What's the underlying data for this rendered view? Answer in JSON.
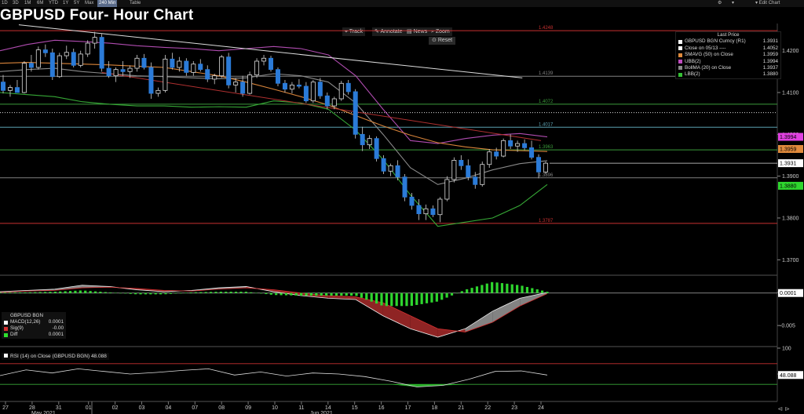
{
  "topbar": {
    "ranges": [
      "1D",
      "3D",
      "1M",
      "6M",
      "YTD",
      "1Y",
      "5Y",
      "Max",
      "240 Min",
      "Table"
    ],
    "active": "240 Min",
    "edit_chart": "Edit Chart"
  },
  "title": "GBPUSD Four- Hour Chart",
  "toolbar": {
    "track": "Track",
    "annotate": "Annotate",
    "news": "News",
    "zoom": "Zoom",
    "reset": "Reset"
  },
  "legend": {
    "header": "Last Price",
    "rows": [
      {
        "label": "GBPUSD BGN Curncy  (R1)",
        "value": "1.3931",
        "color": "#ffffff"
      },
      {
        "label": "Close on 05/13 ----",
        "value": "1.4052",
        "color": "#ffffff"
      },
      {
        "label": "SMAVG (50)  on Close",
        "value": "1.3959",
        "color": "#e08a3c"
      },
      {
        "label": "UBB(2)",
        "value": "1.3994",
        "color": "#c04cc0"
      },
      {
        "label": "BollMA (20)  on Close",
        "value": "1.3937",
        "color": "#8a8a8a"
      },
      {
        "label": "LBB(2)",
        "value": "1.3880",
        "color": "#35c035"
      }
    ]
  },
  "macd_legend": {
    "header": "GBPUSD BGN",
    "rows": [
      {
        "label": "MACD(12,26)",
        "value": "0.0001",
        "color": "#ffffff"
      },
      {
        "label": "Sig(9)",
        "value": "-0.00",
        "color": "#d43030"
      },
      {
        "label": "Diff",
        "value": "0.0001",
        "color": "#2ee02e"
      }
    ]
  },
  "rsi_legend": "RSI (14)  on Close (GBPUSD BGN) 48.088",
  "chart_data": {
    "type": "candlestick",
    "instrument": "GBPUSD BGN Curncy",
    "interval": "240 Min",
    "x_ticks": [
      "27",
      "28",
      "31",
      "01",
      "02",
      "03",
      "04",
      "07",
      "08",
      "09",
      "10",
      "11",
      "14",
      "15",
      "16",
      "17",
      "18",
      "21",
      "22",
      "23",
      "24"
    ],
    "x_months": [
      "May 2021",
      "Jun 2021"
    ],
    "price_axis": {
      "ticks": [
        1.42,
        1.41,
        1.4,
        1.39,
        1.38,
        1.37
      ],
      "labels": [
        "1.4200",
        "1.4100",
        "1.4000",
        "1.3900",
        "1.3800",
        "1.3700"
      ],
      "ylim": [
        1.3665,
        1.4265
      ]
    },
    "price_tags": [
      {
        "text": "1.3994",
        "color": "#e040e0",
        "value": 1.3994
      },
      {
        "text": "1.3959",
        "color": "#e08a3c",
        "value": 1.3965
      },
      {
        "text": "1.3931",
        "color": "#ffffff",
        "value": 1.3931
      },
      {
        "text": "1.3880",
        "color": "#2ed62e",
        "value": 1.3877
      }
    ],
    "horizontal_levels": [
      {
        "label": "1.4248",
        "value": 1.4248,
        "color": "#c83030"
      },
      {
        "label": "1.4139",
        "value": 1.4139,
        "color": "#808080"
      },
      {
        "label": "1.4072",
        "value": 1.4072,
        "color": "#3a9a3a"
      },
      {
        "label": "1.4017",
        "value": 1.4017,
        "color": "#5aa0b0"
      },
      {
        "label": "1.3963",
        "value": 1.3963,
        "color": "#3a9a3a"
      },
      {
        "label": "1.3896",
        "value": 1.3896,
        "color": "#808080"
      },
      {
        "label": "1.3787",
        "value": 1.3787,
        "color": "#c83030"
      }
    ],
    "dotted_level": 1.4052,
    "candles": [
      [
        1.4125,
        1.4142,
        1.4098,
        1.4105
      ],
      [
        1.4105,
        1.4118,
        1.409,
        1.4112
      ],
      [
        1.4112,
        1.413,
        1.41,
        1.41
      ],
      [
        1.41,
        1.4175,
        1.4098,
        1.417
      ],
      [
        1.417,
        1.419,
        1.415,
        1.416
      ],
      [
        1.416,
        1.421,
        1.4155,
        1.4202
      ],
      [
        1.4202,
        1.4215,
        1.4185,
        1.4195
      ],
      [
        1.4195,
        1.4205,
        1.413,
        1.4138
      ],
      [
        1.4138,
        1.4195,
        1.4135,
        1.4188
      ],
      [
        1.4188,
        1.4212,
        1.418,
        1.4196
      ],
      [
        1.4196,
        1.4205,
        1.416,
        1.4165
      ],
      [
        1.4165,
        1.42,
        1.416,
        1.4192
      ],
      [
        1.4192,
        1.4225,
        1.4185,
        1.4218
      ],
      [
        1.4218,
        1.4245,
        1.4205,
        1.4232
      ],
      [
        1.4232,
        1.424,
        1.415,
        1.4158
      ],
      [
        1.4158,
        1.4175,
        1.4135,
        1.414
      ],
      [
        1.414,
        1.416,
        1.4125,
        1.4155
      ],
      [
        1.4155,
        1.4175,
        1.414,
        1.415
      ],
      [
        1.415,
        1.4165,
        1.4135,
        1.4158
      ],
      [
        1.4158,
        1.419,
        1.415,
        1.4182
      ],
      [
        1.4182,
        1.4192,
        1.4155,
        1.416
      ],
      [
        1.416,
        1.4172,
        1.4085,
        1.4098
      ],
      [
        1.4098,
        1.4112,
        1.409,
        1.4105
      ],
      [
        1.4105,
        1.419,
        1.41,
        1.418
      ],
      [
        1.418,
        1.4195,
        1.4155,
        1.416
      ],
      [
        1.416,
        1.4185,
        1.415,
        1.4175
      ],
      [
        1.4175,
        1.4182,
        1.414,
        1.4148
      ],
      [
        1.4148,
        1.4175,
        1.414,
        1.4168
      ],
      [
        1.4168,
        1.418,
        1.415,
        1.4155
      ],
      [
        1.4155,
        1.4165,
        1.4125,
        1.4132
      ],
      [
        1.4132,
        1.4145,
        1.412,
        1.414
      ],
      [
        1.414,
        1.419,
        1.4135,
        1.4185
      ],
      [
        1.4185,
        1.4195,
        1.411,
        1.4118
      ],
      [
        1.4118,
        1.4135,
        1.41,
        1.4125
      ],
      [
        1.4125,
        1.414,
        1.409,
        1.4098
      ],
      [
        1.4098,
        1.415,
        1.4095,
        1.4142
      ],
      [
        1.4142,
        1.4182,
        1.4135,
        1.4175
      ],
      [
        1.4175,
        1.419,
        1.4165,
        1.4182
      ],
      [
        1.4182,
        1.4188,
        1.415,
        1.4155
      ],
      [
        1.4155,
        1.416,
        1.4115,
        1.4122
      ],
      [
        1.4122,
        1.413,
        1.41,
        1.4108
      ],
      [
        1.4108,
        1.4125,
        1.4098,
        1.4118
      ],
      [
        1.4118,
        1.4132,
        1.411,
        1.4115
      ],
      [
        1.4115,
        1.4125,
        1.4075,
        1.408
      ],
      [
        1.408,
        1.413,
        1.4075,
        1.4125
      ],
      [
        1.4125,
        1.4135,
        1.4085,
        1.4092
      ],
      [
        1.4092,
        1.41,
        1.406,
        1.4068
      ],
      [
        1.4068,
        1.409,
        1.406,
        1.4085
      ],
      [
        1.4085,
        1.4128,
        1.408,
        1.4122
      ],
      [
        1.4122,
        1.413,
        1.4095,
        1.4102
      ],
      [
        1.4102,
        1.4108,
        1.399,
        1.4
      ],
      [
        1.4,
        1.4018,
        1.396,
        1.3975
      ],
      [
        1.3975,
        1.3998,
        1.3965,
        1.399
      ],
      [
        1.399,
        1.3995,
        1.3935,
        1.3942
      ],
      [
        1.3942,
        1.395,
        1.3905,
        1.3912
      ],
      [
        1.3912,
        1.393,
        1.39,
        1.3925
      ],
      [
        1.3925,
        1.3938,
        1.389,
        1.3898
      ],
      [
        1.3898,
        1.3905,
        1.384,
        1.385
      ],
      [
        1.385,
        1.386,
        1.382,
        1.383
      ],
      [
        1.383,
        1.3845,
        1.3795,
        1.381
      ],
      [
        1.381,
        1.3832,
        1.3795,
        1.3822
      ],
      [
        1.3822,
        1.383,
        1.3802,
        1.3808
      ],
      [
        1.3808,
        1.385,
        1.379,
        1.3845
      ],
      [
        1.3845,
        1.39,
        1.384,
        1.3892
      ],
      [
        1.3892,
        1.3945,
        1.3885,
        1.3938
      ],
      [
        1.3938,
        1.395,
        1.3915,
        1.3925
      ],
      [
        1.3925,
        1.394,
        1.389,
        1.3898
      ],
      [
        1.3898,
        1.391,
        1.387,
        1.388
      ],
      [
        1.388,
        1.3935,
        1.3875,
        1.3928
      ],
      [
        1.3928,
        1.3965,
        1.392,
        1.3958
      ],
      [
        1.3958,
        1.3968,
        1.394,
        1.3948
      ],
      [
        1.3948,
        1.399,
        1.3945,
        1.3985
      ],
      [
        1.3985,
        1.4,
        1.3965,
        1.3972
      ],
      [
        1.3972,
        1.3985,
        1.3958,
        1.3978
      ],
      [
        1.3978,
        1.3988,
        1.3962,
        1.3968
      ],
      [
        1.3968,
        1.3985,
        1.394,
        1.3945
      ],
      [
        1.3945,
        1.3952,
        1.3895,
        1.391
      ],
      [
        1.391,
        1.3935,
        1.3905,
        1.3931
      ]
    ],
    "sma50": [
      1.417,
      1.4172,
      1.417,
      1.4168,
      1.4166,
      1.4163,
      1.416,
      1.415,
      1.414,
      1.4125,
      1.4108,
      1.409,
      1.407,
      1.4045,
      1.402,
      1.3998,
      1.398,
      1.397,
      1.3963,
      1.3961,
      1.3959
    ],
    "ubb": [
      1.42,
      1.4215,
      1.4225,
      1.4222,
      1.4218,
      1.4212,
      1.4208,
      1.4205,
      1.42,
      1.4205,
      1.421,
      1.4205,
      1.419,
      1.414,
      1.406,
      1.3985,
      1.3978,
      1.399,
      1.3998,
      1.4002,
      1.3994
    ],
    "bollma": [
      1.415,
      1.4155,
      1.4158,
      1.415,
      1.4145,
      1.414,
      1.4138,
      1.4135,
      1.4133,
      1.4135,
      1.4145,
      1.414,
      1.4125,
      1.4075,
      1.4,
      1.392,
      1.388,
      1.3895,
      1.3915,
      1.393,
      1.3937
    ],
    "lbb": [
      1.41,
      1.4095,
      1.409,
      1.4078,
      1.4072,
      1.4068,
      1.4068,
      1.4065,
      1.4066,
      1.4065,
      1.408,
      1.4075,
      1.406,
      1.401,
      1.394,
      1.3855,
      1.378,
      1.379,
      1.38,
      1.383,
      1.388
    ],
    "trendlines": [
      {
        "from": [
          0.5,
          1.4262
        ],
        "to": [
          19.3,
          1.4135
        ],
        "color": "#dddddd"
      },
      {
        "from": [
          3.5,
          1.4148
        ],
        "to": [
          20.2,
          1.3985
        ],
        "color": "#b03030"
      }
    ],
    "macd": {
      "ticks": [
        0.0001,
        -0.005
      ],
      "tick_labels": [
        "0.0001",
        "-0.005"
      ],
      "macd_line": [
        0.0002,
        0.0004,
        0.0006,
        0.0012,
        0.001,
        0.0005,
        0.0002,
        0.0004,
        0.0008,
        0.001,
        0.0002,
        -0.0004,
        -0.0008,
        -0.001,
        -0.0035,
        -0.0055,
        -0.0068,
        -0.0055,
        -0.0028,
        -0.0008,
        0.0001
      ],
      "signal_line": [
        0.0001,
        0.0003,
        0.0004,
        0.0008,
        0.0009,
        0.0007,
        0.0004,
        0.0003,
        0.0006,
        0.0008,
        0.0005,
        0.0,
        -0.0004,
        -0.0006,
        -0.0015,
        -0.0035,
        -0.0055,
        -0.006,
        -0.0045,
        -0.002,
        -0.0001
      ],
      "diff": [
        0.0001,
        0.0001,
        0.0002,
        0.0004,
        0.0001,
        -0.0002,
        -0.0002,
        0.0001,
        0.0002,
        0.0002,
        -0.0003,
        -0.0004,
        -0.0004,
        -0.0004,
        -0.002,
        -0.002,
        -0.0013,
        0.0005,
        0.0017,
        0.0012,
        0.0002
      ]
    },
    "rsi": {
      "ticks": [
        100,
        50
      ],
      "overbought": 70,
      "oversold": 30,
      "last_label": "48.088",
      "values": [
        47,
        58,
        52,
        60,
        55,
        50,
        53,
        57,
        60,
        48,
        54,
        46,
        52,
        50,
        45,
        36,
        25,
        28,
        40,
        55,
        56,
        48
      ]
    }
  }
}
